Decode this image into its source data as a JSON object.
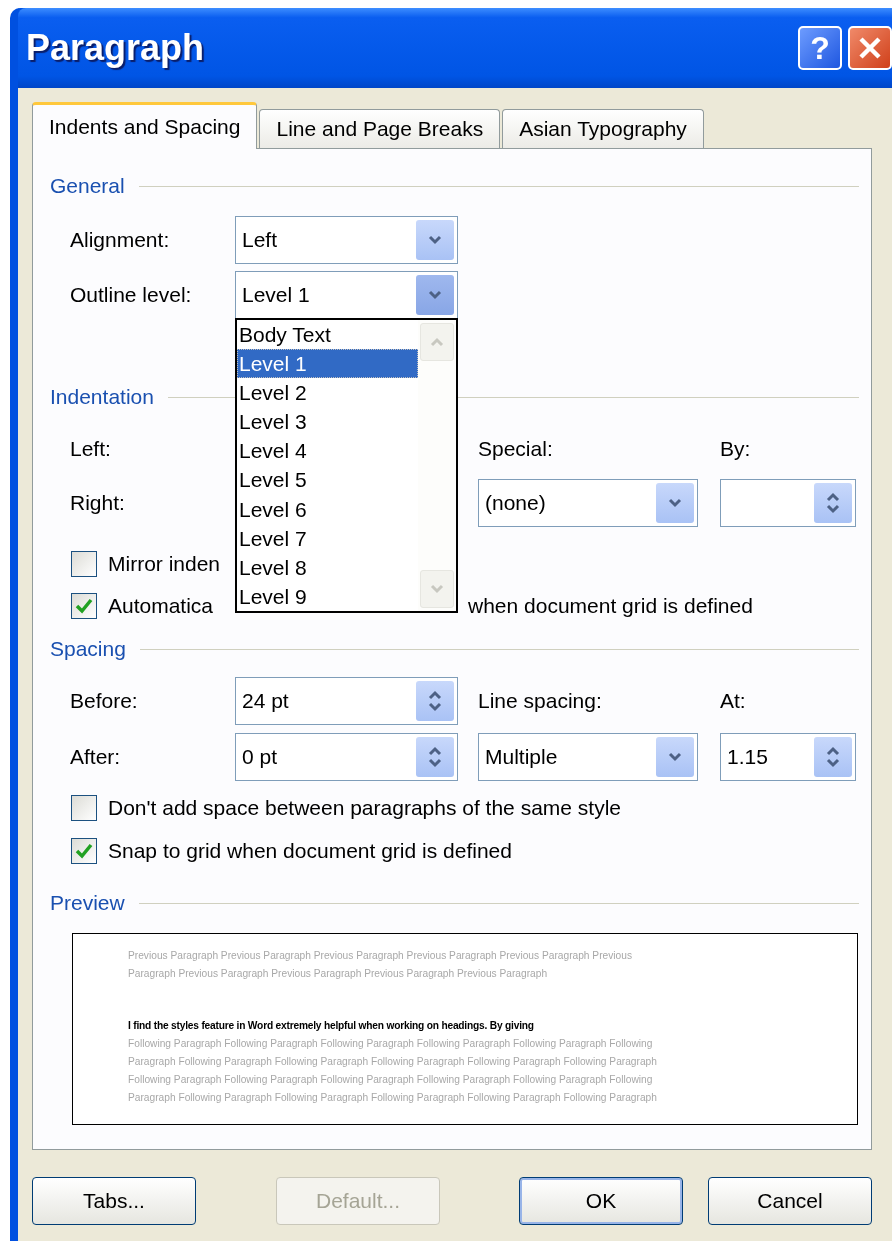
{
  "window": {
    "title": "Paragraph",
    "help_button": "?"
  },
  "tabs": [
    {
      "label": "Indents and Spacing",
      "selected": true
    },
    {
      "label": "Line and Page Breaks",
      "selected": false
    },
    {
      "label": "Asian Typography",
      "selected": false
    }
  ],
  "general": {
    "heading": "General",
    "alignment": {
      "label": "Alignment:",
      "value": "Left"
    },
    "outline_level": {
      "label": "Outline level:",
      "value": "Level 1",
      "expanded": true,
      "options": [
        {
          "label": "Body Text",
          "selected": false
        },
        {
          "label": "Level 1",
          "selected": true
        },
        {
          "label": "Level 2",
          "selected": false
        },
        {
          "label": "Level 3",
          "selected": false
        },
        {
          "label": "Level 4",
          "selected": false
        },
        {
          "label": "Level 5",
          "selected": false
        },
        {
          "label": "Level 6",
          "selected": false
        },
        {
          "label": "Level 7",
          "selected": false
        },
        {
          "label": "Level 8",
          "selected": false
        },
        {
          "label": "Level 9",
          "selected": false
        }
      ]
    }
  },
  "indentation": {
    "heading": "Indentation",
    "left_label": "Left:",
    "right_label": "Right:",
    "special": {
      "label": "Special:",
      "value": "(none)"
    },
    "by": {
      "label": "By:"
    },
    "mirror": {
      "label": "Mirror inden",
      "checked": false
    },
    "auto_adjust": {
      "label_start": "Automatica",
      "label_end": "when document grid is defined",
      "checked": true
    }
  },
  "spacing": {
    "heading": "Spacing",
    "before": {
      "label": "Before:",
      "value": "24 pt"
    },
    "after": {
      "label": "After:",
      "value": "0 pt"
    },
    "line_spacing": {
      "label": "Line spacing:",
      "value": "Multiple"
    },
    "at": {
      "label": "At:",
      "value": "1.15"
    },
    "dont_add": {
      "label": "Don't add space between paragraphs of the same style",
      "checked": false
    },
    "snap": {
      "label": "Snap to grid when document grid is defined",
      "checked": true
    }
  },
  "preview": {
    "heading": "Preview",
    "previous_lines": [
      "Previous Paragraph Previous Paragraph Previous Paragraph Previous Paragraph Previous Paragraph Previous",
      "Paragraph Previous Paragraph Previous Paragraph Previous Paragraph Previous Paragraph"
    ],
    "current_lines": [
      "I find the styles feature in Word extremely helpful when working on headings. By giving"
    ],
    "following_lines": [
      "Following Paragraph Following Paragraph Following Paragraph Following Paragraph Following Paragraph Following",
      "Paragraph Following Paragraph Following Paragraph Following Paragraph Following Paragraph Following Paragraph",
      "Following Paragraph Following Paragraph Following Paragraph Following Paragraph Following Paragraph Following",
      "Paragraph Following Paragraph Following Paragraph Following Paragraph Following Paragraph Following Paragraph"
    ]
  },
  "buttons": [
    {
      "label": "Tabs...",
      "disabled": false,
      "focused": false
    },
    {
      "label": "Default...",
      "disabled": true,
      "focused": false
    },
    {
      "label": "OK",
      "disabled": false,
      "focused": true
    },
    {
      "label": "Cancel",
      "disabled": false,
      "focused": false
    }
  ]
}
